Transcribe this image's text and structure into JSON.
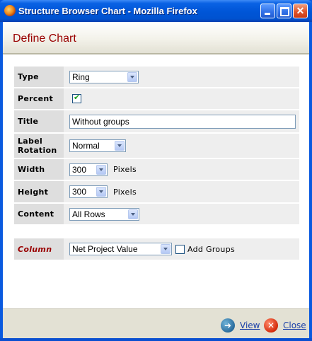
{
  "window": {
    "title": "Structure Browser Chart - Mozilla Firefox"
  },
  "header": {
    "title": "Define Chart"
  },
  "form": {
    "type": {
      "label": "Type",
      "value": "Ring"
    },
    "percent": {
      "label": "Percent",
      "checked": true
    },
    "title": {
      "label": "Title",
      "value": "Without groups"
    },
    "label_rotation": {
      "label_line1": "Label",
      "label_line2": "Rotation",
      "value": "Normal"
    },
    "width": {
      "label": "Width",
      "value": "300",
      "unit": "Pixels"
    },
    "height": {
      "label": "Height",
      "value": "300",
      "unit": "Pixels"
    },
    "content": {
      "label": "Content",
      "value": "All Rows"
    },
    "column": {
      "label": "Column",
      "value": "Net Project Value",
      "add_groups_label": "Add Groups",
      "add_groups_checked": false
    }
  },
  "footer": {
    "view_label": "View",
    "close_label": "Close"
  },
  "icons": {
    "app": "firefox-icon",
    "view": "arrow-right-icon",
    "close": "close-icon"
  }
}
